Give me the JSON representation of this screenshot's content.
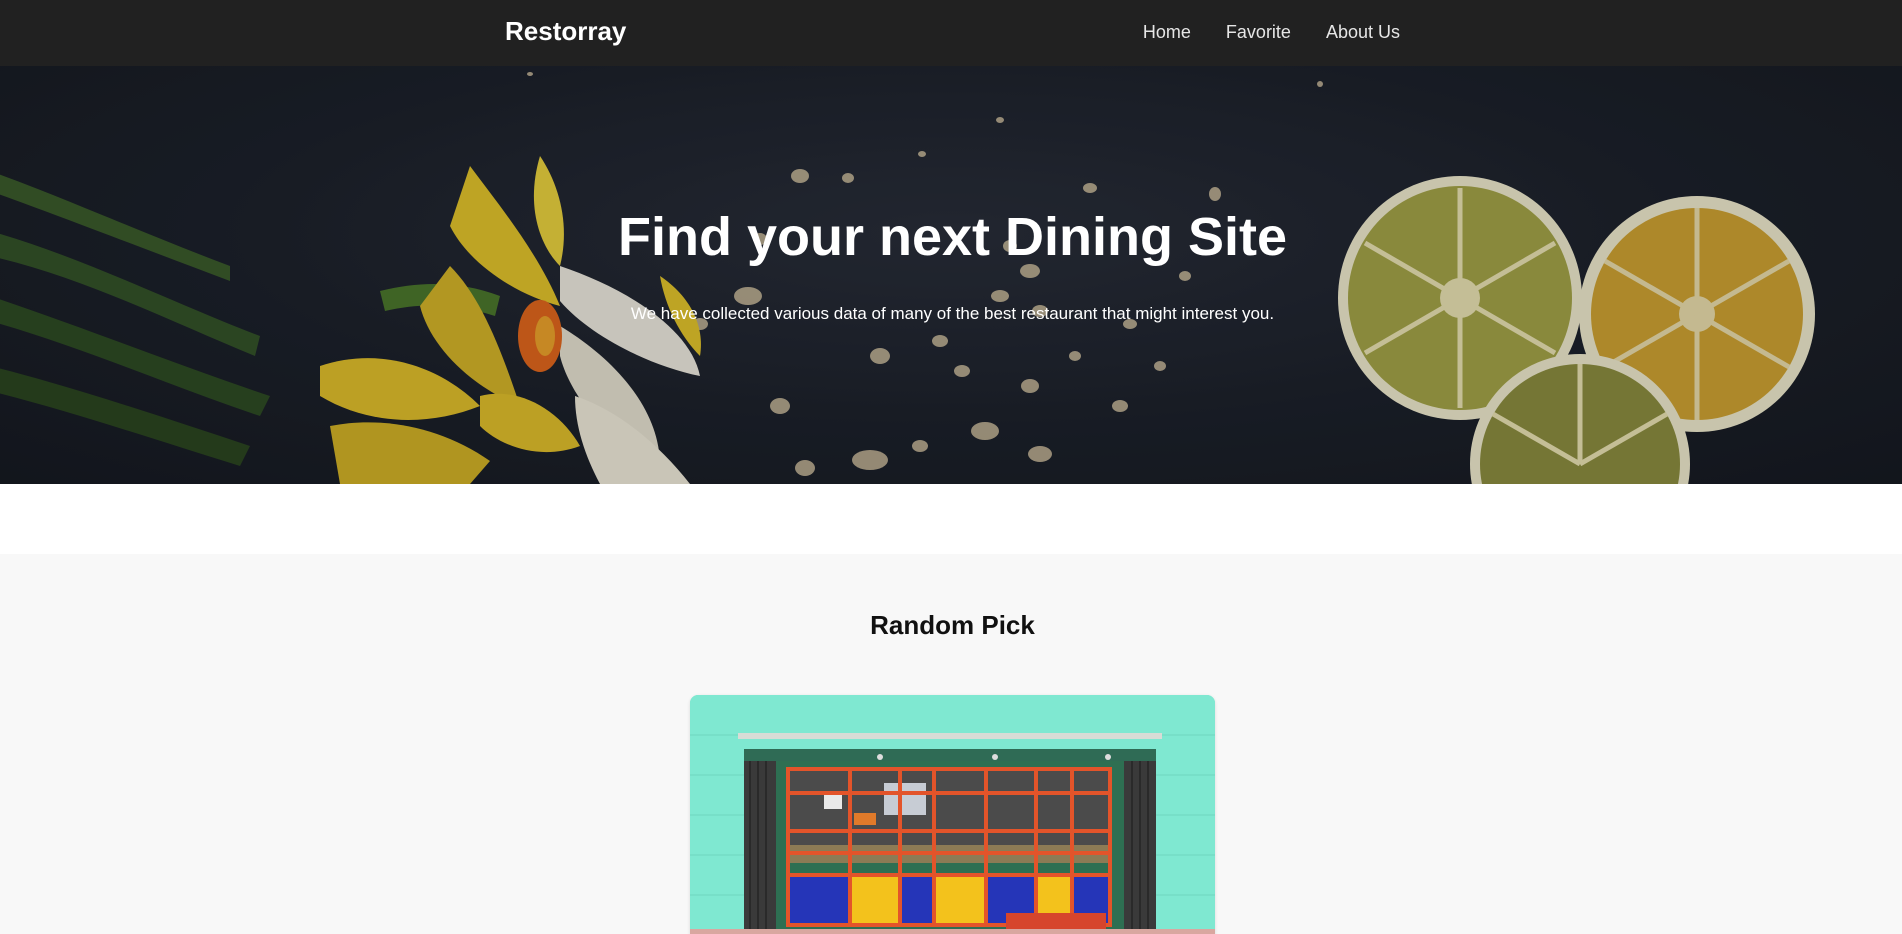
{
  "navbar": {
    "brand": "Restorray",
    "links": [
      {
        "label": "Home"
      },
      {
        "label": "Favorite"
      },
      {
        "label": "About Us"
      }
    ]
  },
  "hero": {
    "title": "Find your next Dining Site",
    "subtitle": "We have collected various data of many of the best restaurant that might interest you."
  },
  "random_pick": {
    "title": "Random Pick"
  },
  "colors": {
    "navbar_bg": "#212121",
    "hero_bg": "#1d222c",
    "section_bg": "#f8f8f8",
    "card_wall": "#7fe8d1"
  }
}
